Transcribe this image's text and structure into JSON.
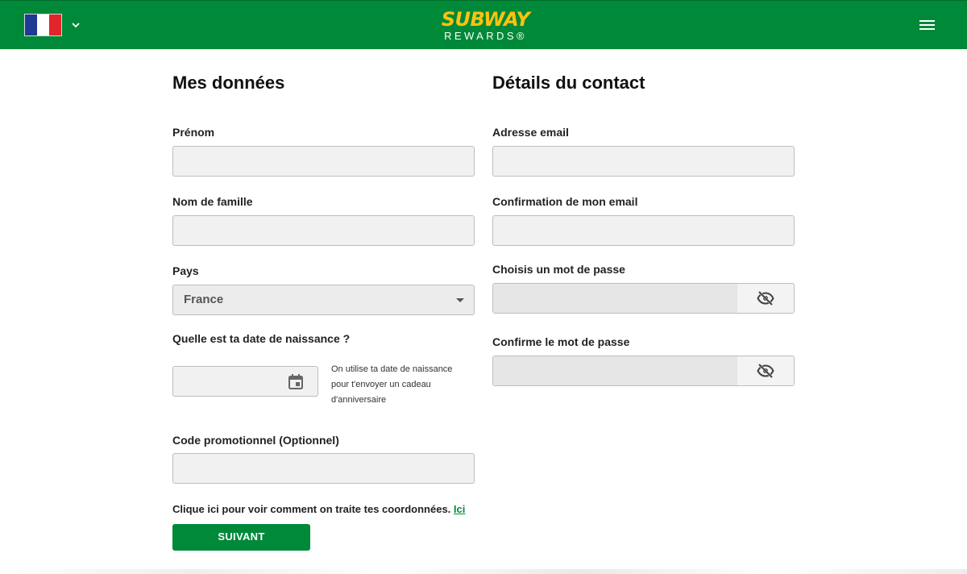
{
  "header": {
    "country_flag": "france-flag",
    "logo_top": "SUBWAY",
    "logo_bottom": "REWARDS®",
    "brand_color": "#008938",
    "accent_color": "#ffc20e"
  },
  "left_column": {
    "title": "Mes données",
    "first_name_label": "Prénom",
    "first_name_value": "",
    "last_name_label": "Nom de famille",
    "last_name_value": "",
    "country_label": "Pays",
    "country_value": "France",
    "birthdate_label": "Quelle est ta date de naissance ?",
    "birthdate_value": "",
    "birthdate_hint": "On utilise ta date de naissance pour t'envoyer un cadeau d'anniversaire",
    "promo_label": "Code promotionnel (Optionnel)",
    "promo_value": ""
  },
  "right_column": {
    "title": "Détails du contact",
    "email_label": "Adresse email",
    "email_value": "",
    "email_confirm_label": "Confirmation de mon email",
    "email_confirm_value": "",
    "password_label": "Choisis un mot de passe",
    "password_confirm_label": "Confirme le mot de passe"
  },
  "footer": {
    "privacy_text": "Clique ici pour voir comment on traite tes coordonnées.",
    "privacy_link": "Ici",
    "next_button": "SUIVANT"
  }
}
